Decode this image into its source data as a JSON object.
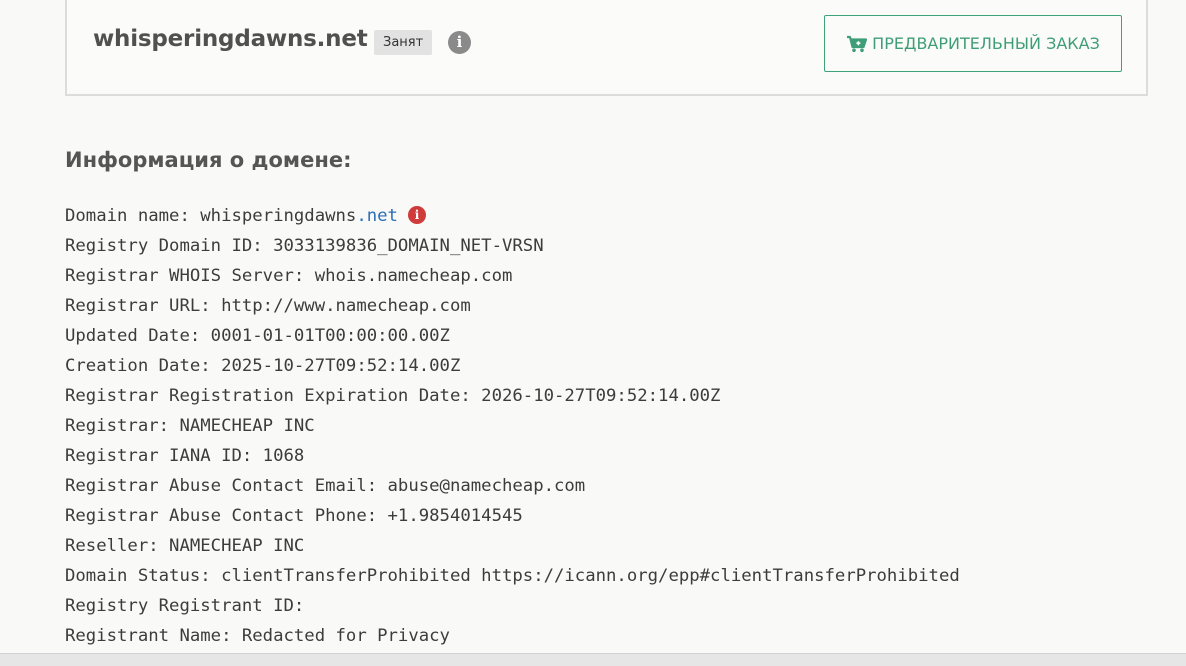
{
  "domain_card": {
    "domain": "whisperingdawns.net",
    "status": "Занят",
    "info_icon": "info-icon",
    "preorder_label": "ПРЕДВАРИТЕЛЬНЫЙ ЗАКАЗ",
    "preorder_icon": "cart-plus-icon"
  },
  "colors": {
    "accent_green": "#3f9e77",
    "link_blue": "#2a6fb8",
    "alert_red": "#cf3b3b"
  },
  "domain_info": {
    "title": "Информация о домене:",
    "domain_name_label": "Domain name: ",
    "domain_name_sld": "whisperingdawns",
    "domain_name_tld": ".net",
    "lines": [
      "Registry Domain ID: 3033139836_DOMAIN_NET-VRSN",
      "Registrar WHOIS Server: whois.namecheap.com",
      "Registrar URL: http://www.namecheap.com",
      "Updated Date: 0001-01-01T00:00:00.00Z",
      "Creation Date: 2025-10-27T09:52:14.00Z",
      "Registrar Registration Expiration Date: 2026-10-27T09:52:14.00Z",
      "Registrar: NAMECHEAP INC",
      "Registrar IANA ID: 1068",
      "Registrar Abuse Contact Email: abuse@namecheap.com",
      "Registrar Abuse Contact Phone: +1.9854014545",
      "Reseller: NAMECHEAP INC",
      "Domain Status: clientTransferProhibited https://icann.org/epp#clientTransferProhibited",
      "Registry Registrant ID: ",
      "Registrant Name: Redacted for Privacy"
    ]
  }
}
